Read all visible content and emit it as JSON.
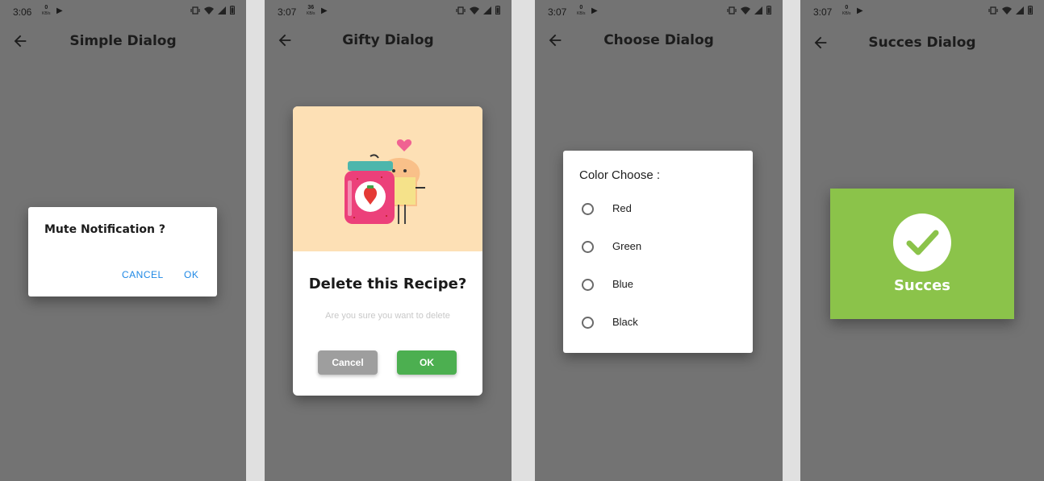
{
  "screens": [
    {
      "status": {
        "time": "3:06",
        "speed_value": "0",
        "speed_unit": "KB/s"
      },
      "title": "Simple Dialog",
      "dialog": {
        "title": "Mute Notification ?",
        "cancel_label": "CANCEL",
        "ok_label": "OK"
      }
    },
    {
      "status": {
        "time": "3:07",
        "speed_value": "36",
        "speed_unit": "KB/s"
      },
      "title": "Gifty Dialog",
      "dialog": {
        "title": "Delete this Recipe?",
        "description": "Are you sure you want to delete",
        "cancel_label": "Cancel",
        "ok_label": "OK"
      }
    },
    {
      "status": {
        "time": "3:07",
        "speed_value": "0",
        "speed_unit": "KB/s"
      },
      "title": "Choose Dialog",
      "dialog": {
        "title": "Color Choose :",
        "options": [
          "Red",
          "Green",
          "Blue",
          "Black"
        ]
      }
    },
    {
      "status": {
        "time": "3:07",
        "speed_value": "0",
        "speed_unit": "KB/s"
      },
      "title": "Succes Dialog",
      "dialog": {
        "label": "Succes"
      }
    }
  ],
  "colors": {
    "scrim": "#737373",
    "link_blue": "#1e88e5",
    "ok_green": "#4caf50",
    "cancel_gray": "#9e9e9e",
    "success_green": "#8bc34a"
  }
}
